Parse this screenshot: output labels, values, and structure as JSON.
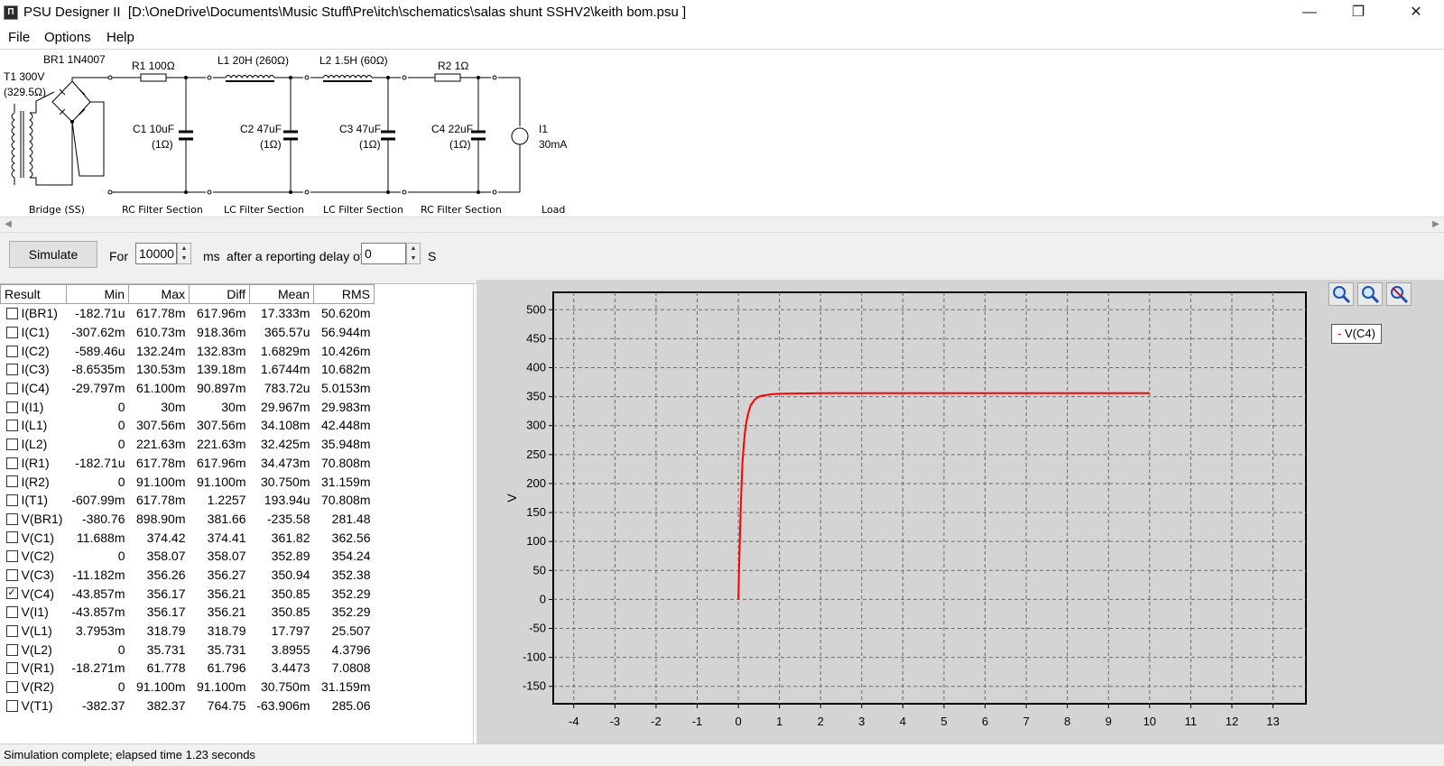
{
  "window": {
    "app_title": "PSU Designer II",
    "file_path": "[D:\\OneDrive\\Documents\\Music Stuff\\Pre\\itch\\schematics\\salas shunt SSHV2\\keith bom.psu ]",
    "app_icon": "psu-app-icon",
    "minimize_glyph": "—",
    "restore_glyph": "❐",
    "close_glyph": "✕"
  },
  "menu": [
    "File",
    "Options",
    "Help"
  ],
  "schematic": {
    "labels": {
      "t1_name": "T1 300V",
      "t1_res": "(329.5Ω)",
      "br1": "BR1 1N4007",
      "r1": "R1 100Ω",
      "l1": "L1 20H (260Ω)",
      "l2": "L2 1.5H (60Ω)",
      "r2": "R2 1Ω",
      "c1": "C1 10uF",
      "c1_res": "(1Ω)",
      "c2": "C2 47uF",
      "c2_res": "(1Ω)",
      "c3": "C3 47uF",
      "c3_res": "(1Ω)",
      "c4": "C4 22uF",
      "c4_res": "(1Ω)",
      "i1": "I1",
      "i1_val": "30mA"
    },
    "sections": [
      "Bridge (SS)",
      "RC Filter Section",
      "LC Filter Section",
      "LC Filter Section",
      "RC Filter Section",
      "Load"
    ]
  },
  "controls": {
    "simulate_label": "Simulate",
    "for_label": "For",
    "duration_value": "10000",
    "ms_label": "ms",
    "delay_label": "after a reporting delay of",
    "delay_value": "0",
    "s_label": "S"
  },
  "results": {
    "columns": [
      "Result",
      "Min",
      "Max",
      "Diff",
      "Mean",
      "RMS"
    ],
    "rows": [
      {
        "name": "I(BR1)",
        "min": "-182.71u",
        "max": "617.78m",
        "diff": "617.96m",
        "mean": "17.333m",
        "rms": "50.620m",
        "checked": false
      },
      {
        "name": "I(C1)",
        "min": "-307.62m",
        "max": "610.73m",
        "diff": "918.36m",
        "mean": "365.57u",
        "rms": "56.944m",
        "checked": false
      },
      {
        "name": "I(C2)",
        "min": "-589.46u",
        "max": "132.24m",
        "diff": "132.83m",
        "mean": "1.6829m",
        "rms": "10.426m",
        "checked": false
      },
      {
        "name": "I(C3)",
        "min": "-8.6535m",
        "max": "130.53m",
        "diff": "139.18m",
        "mean": "1.6744m",
        "rms": "10.682m",
        "checked": false
      },
      {
        "name": "I(C4)",
        "min": "-29.797m",
        "max": "61.100m",
        "diff": "90.897m",
        "mean": "783.72u",
        "rms": "5.0153m",
        "checked": false
      },
      {
        "name": "I(I1)",
        "min": "0",
        "max": "30m",
        "diff": "30m",
        "mean": "29.967m",
        "rms": "29.983m",
        "checked": false
      },
      {
        "name": "I(L1)",
        "min": "0",
        "max": "307.56m",
        "diff": "307.56m",
        "mean": "34.108m",
        "rms": "42.448m",
        "checked": false
      },
      {
        "name": "I(L2)",
        "min": "0",
        "max": "221.63m",
        "diff": "221.63m",
        "mean": "32.425m",
        "rms": "35.948m",
        "checked": false
      },
      {
        "name": "I(R1)",
        "min": "-182.71u",
        "max": "617.78m",
        "diff": "617.96m",
        "mean": "34.473m",
        "rms": "70.808m",
        "checked": false
      },
      {
        "name": "I(R2)",
        "min": "0",
        "max": "91.100m",
        "diff": "91.100m",
        "mean": "30.750m",
        "rms": "31.159m",
        "checked": false
      },
      {
        "name": "I(T1)",
        "min": "-607.99m",
        "max": "617.78m",
        "diff": "1.2257",
        "mean": "193.94u",
        "rms": "70.808m",
        "checked": false
      },
      {
        "name": "V(BR1)",
        "min": "-380.76",
        "max": "898.90m",
        "diff": "381.66",
        "mean": "-235.58",
        "rms": "281.48",
        "checked": false
      },
      {
        "name": "V(C1)",
        "min": "11.688m",
        "max": "374.42",
        "diff": "374.41",
        "mean": "361.82",
        "rms": "362.56",
        "checked": false
      },
      {
        "name": "V(C2)",
        "min": "0",
        "max": "358.07",
        "diff": "358.07",
        "mean": "352.89",
        "rms": "354.24",
        "checked": false
      },
      {
        "name": "V(C3)",
        "min": "-11.182m",
        "max": "356.26",
        "diff": "356.27",
        "mean": "350.94",
        "rms": "352.38",
        "checked": false
      },
      {
        "name": "V(C4)",
        "min": "-43.857m",
        "max": "356.17",
        "diff": "356.21",
        "mean": "350.85",
        "rms": "352.29",
        "checked": true
      },
      {
        "name": "V(I1)",
        "min": "-43.857m",
        "max": "356.17",
        "diff": "356.21",
        "mean": "350.85",
        "rms": "352.29",
        "checked": false
      },
      {
        "name": "V(L1)",
        "min": "3.7953m",
        "max": "318.79",
        "diff": "318.79",
        "mean": "17.797",
        "rms": "25.507",
        "checked": false
      },
      {
        "name": "V(L2)",
        "min": "0",
        "max": "35.731",
        "diff": "35.731",
        "mean": "3.8955",
        "rms": "4.3796",
        "checked": false
      },
      {
        "name": "V(R1)",
        "min": "-18.271m",
        "max": "61.778",
        "diff": "61.796",
        "mean": "3.4473",
        "rms": "7.0808",
        "checked": false
      },
      {
        "name": "V(R2)",
        "min": "0",
        "max": "91.100m",
        "diff": "91.100m",
        "mean": "30.750m",
        "rms": "31.159m",
        "checked": false
      },
      {
        "name": "V(T1)",
        "min": "-382.37",
        "max": "382.37",
        "diff": "764.75",
        "mean": "-63.906m",
        "rms": "285.06",
        "checked": false
      }
    ]
  },
  "zoom_icons": [
    "zoom-in-icon",
    "zoom-out-icon",
    "zoom-reset-icon"
  ],
  "chart_data": {
    "type": "line",
    "xlabel": "",
    "ylabel": "V",
    "xlim": [
      -4.5,
      13.8
    ],
    "ylim": [
      -180,
      530
    ],
    "xticks": [
      -4,
      -3,
      -2,
      -1,
      0,
      1,
      2,
      3,
      4,
      5,
      6,
      7,
      8,
      9,
      10,
      11,
      12,
      13
    ],
    "yticks": [
      500,
      450,
      400,
      350,
      300,
      250,
      200,
      150,
      100,
      50,
      0,
      -50,
      -100,
      -150
    ],
    "grid": true,
    "legend_position": "right, outside plot",
    "series": [
      {
        "name": "V(C4)",
        "color": "#ff0000",
        "x": [
          0,
          0.02,
          0.05,
          0.08,
          0.1,
          0.13,
          0.16,
          0.2,
          0.25,
          0.3,
          0.4,
          0.5,
          0.6,
          0.8,
          1.0,
          2.0,
          4.0,
          6.0,
          8.0,
          10.0
        ],
        "y": [
          0,
          60,
          140,
          200,
          235,
          265,
          288,
          308,
          324,
          335,
          345,
          350,
          352,
          354,
          355,
          356,
          356,
          356,
          356,
          356
        ]
      }
    ]
  },
  "status": {
    "text": "Simulation complete; elapsed time 1.23 seconds"
  }
}
